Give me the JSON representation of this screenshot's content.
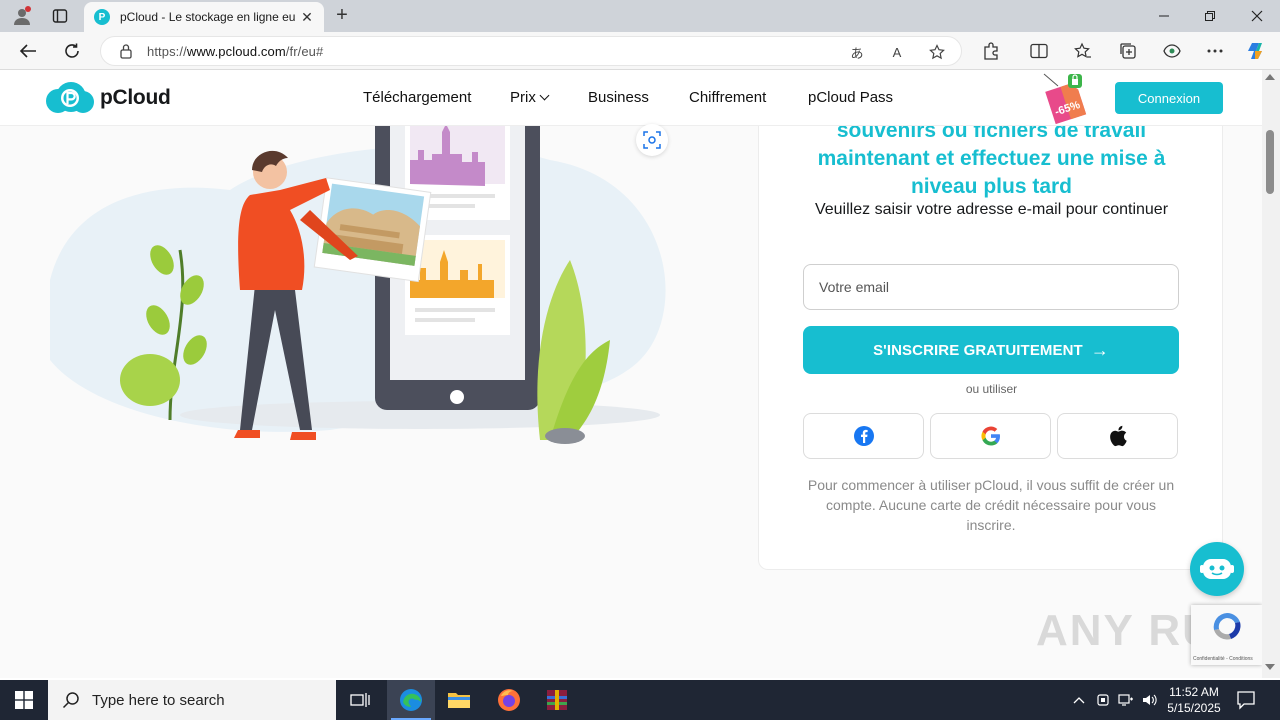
{
  "browser": {
    "tab_title": "pCloud - Le stockage en ligne eu",
    "url_prefix": "https://",
    "url_domain": "www.pcloud.com",
    "url_path": "/fr/eu#"
  },
  "site": {
    "logo_text": "pCloud",
    "nav": [
      "Téléchargement",
      "Prix",
      "Business",
      "Chiffrement",
      "pCloud Pass"
    ],
    "promo_badge": "-65%",
    "login_label": "Connexion"
  },
  "signup": {
    "heading_lines": [
      "souvenirs ou fichiers de travail",
      "maintenant et effectuez une mise à",
      "niveau plus tard"
    ],
    "subtitle": "Veuillez saisir votre adresse e-mail pour continuer",
    "email_placeholder": "Votre email",
    "cta_label": "S'INSCRIRE GRATUITEMENT",
    "or_use": "ou utiliser",
    "note": "Pour commencer à utiliser pCloud, il vous suffit de créer un compte. Aucune carte de crédit nécessaire pour vous inscrire."
  },
  "overlay": {
    "recaptcha_text": "Confidentialité - Conditions",
    "watermark": "ANY RUN"
  },
  "taskbar": {
    "search_placeholder": "Type here to search",
    "time": "11:52 AM",
    "date": "5/15/2025"
  },
  "colors": {
    "accent": "#17bed0",
    "taskbar": "#1f2634"
  }
}
